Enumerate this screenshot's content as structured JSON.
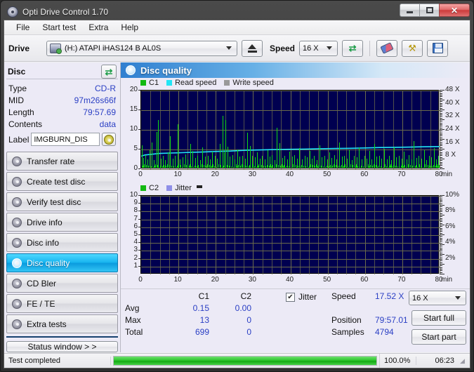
{
  "window": {
    "title": "Opti Drive Control 1.70",
    "app_icon": "disc-icon",
    "minimize": "minimize-icon",
    "maximize": "maximize-icon",
    "close": "close-icon"
  },
  "menu": [
    {
      "label": "File"
    },
    {
      "label": "Start test"
    },
    {
      "label": "Extra"
    },
    {
      "label": "Help"
    }
  ],
  "toolbar": {
    "drive_label": "Drive",
    "drive_value": "(H:)   ATAPI iHAS124   B AL0S",
    "eject_icon": "eject-icon",
    "speed_label": "Speed",
    "speed_value": "16 X",
    "refresh_icon": "refresh-icon",
    "eraser_icon": "eraser-icon",
    "tools_icon": "tools-icon",
    "save_icon": "save-icon"
  },
  "disc": {
    "title": "Disc",
    "refresh_icon": "refresh-icon",
    "rows": [
      {
        "key": "Type",
        "value": "CD-R"
      },
      {
        "key": "MID",
        "value": "97m26s66f"
      },
      {
        "key": "Length",
        "value": "79:57.69"
      },
      {
        "key": "Contents",
        "value": "data"
      }
    ],
    "label_key": "Label",
    "label_value": "IMGBURN_DIS",
    "label_icon": "cd-icon"
  },
  "sidebar": {
    "items": [
      {
        "label": "Transfer rate",
        "icon": "disc-icon",
        "active": false
      },
      {
        "label": "Create test disc",
        "icon": "disc-icon",
        "active": false
      },
      {
        "label": "Verify test disc",
        "icon": "disc-icon",
        "active": false
      },
      {
        "label": "Drive info",
        "icon": "disc-icon",
        "active": false
      },
      {
        "label": "Disc info",
        "icon": "disc-icon",
        "active": false
      },
      {
        "label": "Disc quality",
        "icon": "disc-icon",
        "active": true
      },
      {
        "label": "CD Bler",
        "icon": "disc-icon",
        "active": false
      },
      {
        "label": "FE / TE",
        "icon": "disc-icon",
        "active": false
      },
      {
        "label": "Extra tests",
        "icon": "disc-icon",
        "active": false
      }
    ],
    "status_window": "Status window > >"
  },
  "panel": {
    "header": "Disc quality",
    "header_icon": "disc-icon"
  },
  "chart_data": [
    {
      "type": "line",
      "title": "Disc quality - C1 / Read speed",
      "xlabel": "min",
      "ylabel": "",
      "xlim": [
        0,
        80
      ],
      "ylim": [
        0,
        20
      ],
      "y2lim": [
        0,
        48
      ],
      "grid": true,
      "legend_position": "top-left",
      "xticks": [
        0,
        10,
        20,
        30,
        40,
        50,
        60,
        70,
        80
      ],
      "yticks": [
        0,
        5,
        10,
        15,
        20
      ],
      "y2ticks": [
        "8 X",
        "16 X",
        "24 X",
        "32 X",
        "40 X",
        "48 X"
      ],
      "legend": [
        {
          "name": "C1",
          "color": "#12b912"
        },
        {
          "name": "Read speed",
          "color": "#22e5f5"
        },
        {
          "name": "Write speed",
          "color": "#9a9a9a"
        }
      ],
      "series": [
        {
          "name": "Read speed",
          "color": "#22e5f5",
          "x": [
            0,
            1,
            3,
            5,
            8,
            11,
            14,
            17,
            20,
            24,
            28,
            32,
            36,
            40,
            44,
            48,
            52,
            56,
            60,
            64,
            68,
            72,
            76,
            80
          ],
          "values": [
            3.3,
            3.6,
            3.8,
            4.0,
            4.1,
            4.2,
            4.3,
            4.4,
            4.5,
            4.6,
            4.8,
            4.9,
            5.0,
            5.05,
            5.1,
            5.2,
            5.25,
            5.3,
            5.4,
            5.5,
            5.55,
            5.6,
            5.7,
            5.75
          ]
        },
        {
          "name": "C1",
          "color": "#12d912",
          "x": [
            0.2,
            0.5,
            1.1,
            1.6,
            2.2,
            2.9,
            3.4,
            4.1,
            4.6,
            5.2,
            5.8,
            6.4,
            7.1,
            7.8,
            8.4,
            9.1,
            9.8,
            10.4,
            11.1,
            11.8,
            12.4,
            13.1,
            13.8,
            14.4,
            15.1,
            15.8,
            16.4,
            17.1,
            17.8,
            18.4,
            19.1,
            19.8,
            20.4,
            21.1,
            21.8,
            22.2,
            22.6,
            23.1,
            23.8,
            24.4,
            25.1,
            25.8,
            26.4,
            27.1,
            27.8,
            28.4,
            29.1,
            29.8,
            30.4,
            31.1,
            31.8,
            32.4,
            33.1,
            33.8,
            34.4,
            35.1,
            35.8,
            36.4,
            37.1,
            37.8,
            38.4,
            39.1,
            39.8,
            40.4,
            41.1,
            41.8,
            42.4,
            43.1,
            43.8,
            44.4,
            45.1,
            45.8,
            46.4,
            47.1,
            47.8,
            48.4,
            49.1,
            49.8,
            50.4,
            51.1,
            51.8,
            52.4,
            53.1,
            53.8,
            54.4,
            55.1,
            55.8,
            56.4,
            57.1,
            57.8,
            58.4,
            59.1,
            59.8,
            60.4,
            61.1,
            61.8,
            62.4,
            63.1,
            63.8,
            64.4,
            65.1,
            65.8,
            66.4,
            67.1,
            67.8,
            68.4,
            69.1,
            69.8,
            70.4,
            71.1,
            71.8,
            72.4,
            73.1,
            73.8,
            74.4,
            75.1,
            75.8,
            76.4,
            77.1,
            77.8,
            78.4,
            79.1,
            79.6
          ],
          "values": [
            5.8,
            2.5,
            3.2,
            2.1,
            4.5,
            6.4,
            2.0,
            9.1,
            12.2,
            2.3,
            3.1,
            2.0,
            4.0,
            8.0,
            2.4,
            3.0,
            11.0,
            2.2,
            2.6,
            3.4,
            2.1,
            6.0,
            4.2,
            2.5,
            3.1,
            2.0,
            5.2,
            2.8,
            3.0,
            2.2,
            4.1,
            3.0,
            2.4,
            6.1,
            13.2,
            4.0,
            12.1,
            5.4,
            2.8,
            3.3,
            2.2,
            4.6,
            2.9,
            3.0,
            2.4,
            9.0,
            5.5,
            3.1,
            2.6,
            4.0,
            2.3,
            3.0,
            2.1,
            4.4,
            2.8,
            3.2,
            2.0,
            10.2,
            6.2,
            2.5,
            3.0,
            2.2,
            4.1,
            2.9,
            3.3,
            2.4,
            5.0,
            2.1,
            3.0,
            2.6,
            4.2,
            2.3,
            3.1,
            2.0,
            5.8,
            2.7,
            3.0,
            2.2,
            4.0,
            2.5,
            3.2,
            2.1,
            6.4,
            2.8,
            3.0,
            2.3,
            4.5,
            2.0,
            3.1,
            2.6,
            5.1,
            2.2,
            3.0,
            2.4,
            4.2,
            2.1,
            6.0,
            2.8,
            3.0,
            2.3,
            4.8,
            2.2,
            3.1,
            2.0,
            5.2,
            2.6,
            3.0,
            2.4,
            4.1,
            2.2,
            3.3,
            2.1,
            6.8,
            2.5,
            3.0,
            2.3,
            4.4,
            2.0,
            3.1,
            2.7,
            5.0,
            2.2,
            3.0,
            7.1
          ]
        }
      ]
    },
    {
      "type": "line",
      "title": "Disc quality - C2 / Jitter",
      "xlabel": "min",
      "ylabel": "",
      "xlim": [
        0,
        80
      ],
      "ylim": [
        0,
        10
      ],
      "y2lim": [
        0,
        10
      ],
      "grid": true,
      "legend_position": "top-left",
      "xticks": [
        0,
        10,
        20,
        30,
        40,
        50,
        60,
        70,
        80
      ],
      "yticks": [
        1,
        2,
        3,
        4,
        5,
        6,
        7,
        8,
        9,
        10
      ],
      "y2ticks": [
        "2%",
        "4%",
        "6%",
        "8%",
        "10%"
      ],
      "legend": [
        {
          "name": "C2",
          "color": "#12b912"
        },
        {
          "name": "Jitter",
          "color": "#8f8fe8"
        }
      ],
      "series": [
        {
          "name": "C2",
          "color": "#12d912",
          "x": [],
          "values": []
        },
        {
          "name": "Jitter",
          "color": "#8f8fe8",
          "x": [],
          "values": []
        }
      ]
    }
  ],
  "stats": {
    "col_headers": [
      "C1",
      "C2"
    ],
    "rows": [
      {
        "label": "Avg",
        "c1": "0.15",
        "c2": "0.00"
      },
      {
        "label": "Max",
        "c1": "13",
        "c2": "0"
      },
      {
        "label": "Total",
        "c1": "699",
        "c2": "0"
      }
    ],
    "jitter_label": "Jitter",
    "jitter_checked": true,
    "speed_label": "Speed",
    "speed_value": "17.52 X",
    "position_label": "Position",
    "position_value": "79:57.01",
    "samples_label": "Samples",
    "samples_value": "4794",
    "speed_select": "16 X",
    "start_full": "Start full",
    "start_part": "Start part"
  },
  "statusbar": {
    "message": "Test completed",
    "percent": "100.0%",
    "progress": 100,
    "elapsed": "06:23"
  },
  "colors": {
    "accent": "#2a3fc4",
    "plot_bg": "#000050",
    "grid": "#6b6b4a",
    "c1": "#12d912",
    "read_speed": "#22e5f5",
    "write_speed": "#9a9a9a",
    "jitter": "#8f8fe8",
    "progress": "#2ec62e",
    "nav_active": "#18b4ef"
  }
}
